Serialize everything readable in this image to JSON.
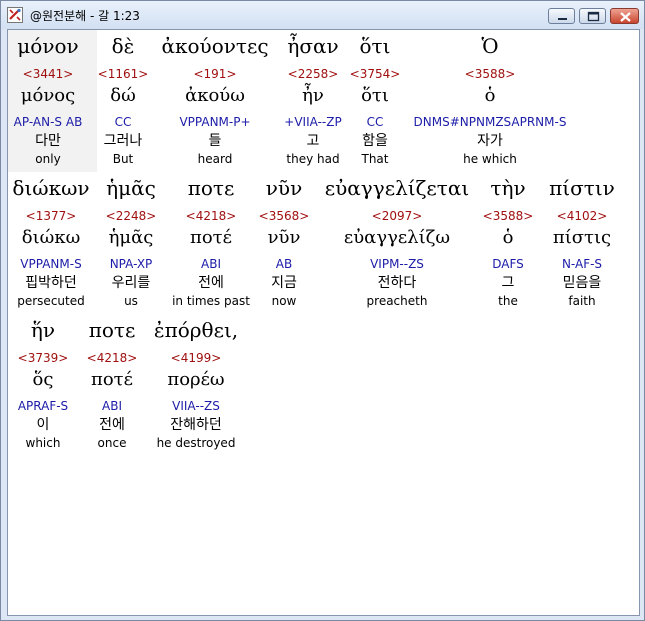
{
  "window": {
    "title": "@원전분해 - 갈 1:23"
  },
  "rows": [
    [
      {
        "greek": "μόνον",
        "strong": "<3441>",
        "lemma": "μόνος",
        "parse": "AP-AN-S AB",
        "korean": "다만",
        "english": "only"
      },
      {
        "greek": "δὲ",
        "strong": "<1161>",
        "lemma": "δώ",
        "parse": "CC",
        "korean": "그러나",
        "english": "But"
      },
      {
        "greek": "ἀκούοντες",
        "strong": "<191>",
        "lemma": "ἀκούω",
        "parse": "VPPANM-P+",
        "korean": "들",
        "english": "heard"
      },
      {
        "greek": "ἦσαν",
        "strong": "<2258>",
        "lemma": "ἦν",
        "parse": "+VIIA--ZP",
        "korean": "고",
        "english": "they had"
      },
      {
        "greek": "ὅτι",
        "strong": "<3754>",
        "lemma": "ὅτι",
        "parse": "CC",
        "korean": "함을",
        "english": "That"
      },
      {
        "greek": "Ὁ",
        "strong": "<3588>",
        "lemma": "ὁ",
        "parse": "DNMS#NPNMZSAPRNM-S",
        "korean": "자가",
        "english": "he which"
      }
    ],
    [
      {
        "greek": "διώκων",
        "strong": "<1377>",
        "lemma": "διώκω",
        "parse": "VPPANM-S",
        "korean": "핍박하던",
        "english": "persecuted"
      },
      {
        "greek": "ἡμᾶς",
        "strong": "<2248>",
        "lemma": "ἡμᾶς",
        "parse": "NPA-XP",
        "korean": "우리를",
        "english": "us"
      },
      {
        "greek": "ποτε",
        "strong": "<4218>",
        "lemma": "ποτέ",
        "parse": "ABI",
        "korean": "전에",
        "english": "in times past"
      },
      {
        "greek": "νῦν",
        "strong": "<3568>",
        "lemma": "νῦν",
        "parse": "AB",
        "korean": "지금",
        "english": "now"
      },
      {
        "greek": "εὐαγγελίζεται",
        "strong": "<2097>",
        "lemma": "εὐαγγελίζω",
        "parse": "VIPM--ZS",
        "korean": "전하다",
        "english": "preacheth"
      },
      {
        "greek": "τὴν",
        "strong": "<3588>",
        "lemma": "ὁ",
        "parse": "DAFS",
        "korean": "그",
        "english": "the"
      },
      {
        "greek": "πίστιν",
        "strong": "<4102>",
        "lemma": "πίστις",
        "parse": "N-AF-S",
        "korean": "믿음을",
        "english": "faith"
      }
    ],
    [
      {
        "greek": "ἥν",
        "strong": "<3739>",
        "lemma": "ὅς",
        "parse": "APRAF-S",
        "korean": "이",
        "english": "which"
      },
      {
        "greek": "ποτε",
        "strong": "<4218>",
        "lemma": "ποτέ",
        "parse": "ABI",
        "korean": "전에",
        "english": "once"
      },
      {
        "greek": "ἐπόρθει,",
        "strong": "<4199>",
        "lemma": "πορέω",
        "parse": "VIIA--ZS",
        "korean": "잔해하던",
        "english": "he destroyed"
      }
    ]
  ]
}
